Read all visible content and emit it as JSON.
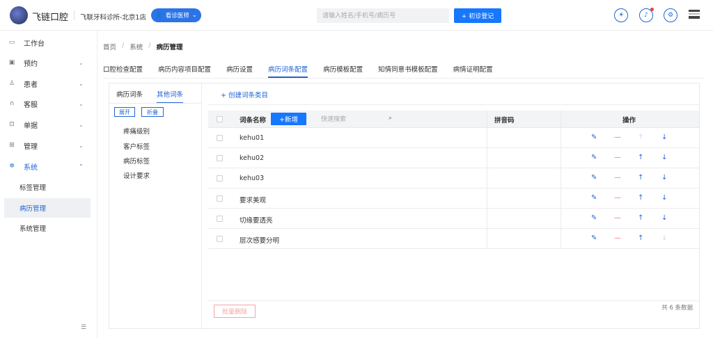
{
  "header": {
    "logo_text": "飞链口腔",
    "clinic": "飞联牙科诊所-北京1店",
    "doctor_btn": "看诊医师",
    "search_placeholder": "请输入姓名/手机号/病历号",
    "register_btn": "+ 初诊登记"
  },
  "sidebar": {
    "items": [
      {
        "label": "工作台",
        "icon": "desktop-icon"
      },
      {
        "label": "预约",
        "icon": "calendar-icon"
      },
      {
        "label": "患者",
        "icon": "user-icon"
      },
      {
        "label": "客服",
        "icon": "headset-icon"
      },
      {
        "label": "单据",
        "icon": "document-icon"
      },
      {
        "label": "管理",
        "icon": "grid-icon"
      },
      {
        "label": "系统",
        "icon": "gear-icon"
      }
    ],
    "sub_items": [
      "标签管理",
      "病历管理",
      "系统管理"
    ]
  },
  "breadcrumb": [
    "首页",
    "系统",
    "病历管理"
  ],
  "tabs": [
    "口腔检查配置",
    "病历内容项目配置",
    "病历设置",
    "病历词条配置",
    "病历模板配置",
    "知情同意书模板配置",
    "病情证明配置"
  ],
  "left_panel": {
    "tabs": [
      "病历词条",
      "其他词条"
    ],
    "expand": "展开",
    "collapse": "折叠",
    "categories": [
      "疼痛级别",
      "客户标签",
      "病历标签",
      "设计要求"
    ]
  },
  "right_panel": {
    "create_link": "+ 创建词条类目",
    "col_name": "词条名称",
    "add_btn": "+新增",
    "quick_search_placeholder": "快速搜索",
    "col_pinyin": "拼音码",
    "col_ops": "操作",
    "rows": [
      {
        "name": "kehu01",
        "pinyin": ""
      },
      {
        "name": "kehu02",
        "pinyin": ""
      },
      {
        "name": "kehu03",
        "pinyin": ""
      },
      {
        "name": "要求美观",
        "pinyin": ""
      },
      {
        "name": "切缘要透亮",
        "pinyin": ""
      },
      {
        "name": "层次感要分明",
        "pinyin": ""
      }
    ],
    "bulk_delete": "批量删除",
    "total": "共 6 条数据"
  },
  "colors": {
    "primary": "#1677ff",
    "danger": "#e86d6d"
  }
}
